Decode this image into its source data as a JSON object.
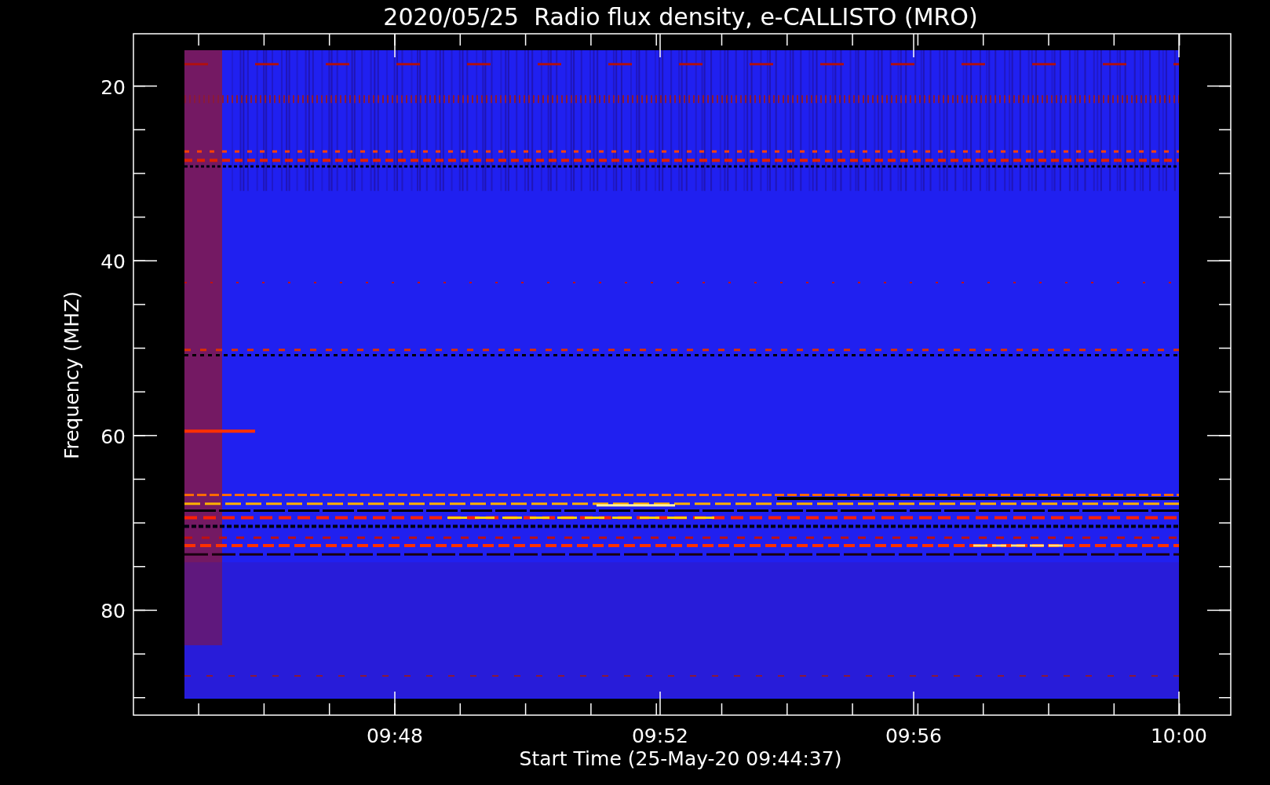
{
  "plot": {
    "title": "2020/05/25  Radio flux density, e-CALLISTO (MRO)",
    "y_axis": {
      "label": "Frequency (MHZ)",
      "ticks": [
        "20",
        "40",
        "60",
        "80"
      ]
    },
    "x_axis": {
      "label": "Start Time (25-May-20 09:44:37)",
      "ticks": [
        "09:48",
        "09:52",
        "09:56",
        "10:00"
      ]
    }
  }
}
